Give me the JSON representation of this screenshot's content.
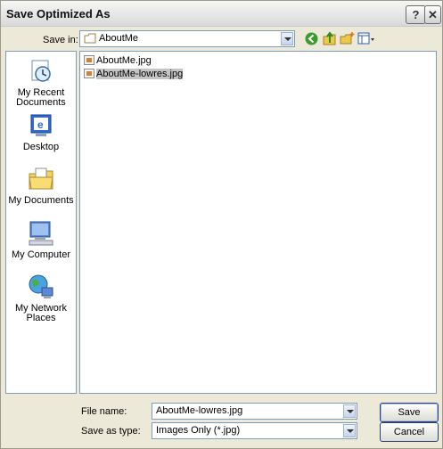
{
  "window": {
    "title": "Save Optimized As",
    "help_glyph": "?",
    "close_glyph": "✕"
  },
  "toolbar": {
    "save_in_label": "Save in:",
    "save_in_value": "AboutMe"
  },
  "places": [
    {
      "label": "My Recent Documents",
      "icon": "recent-documents-icon"
    },
    {
      "label": "Desktop",
      "icon": "desktop-icon"
    },
    {
      "label": "My Documents",
      "icon": "my-documents-icon"
    },
    {
      "label": "My Computer",
      "icon": "my-computer-icon"
    },
    {
      "label": "My Network Places",
      "icon": "network-places-icon"
    }
  ],
  "files": [
    {
      "name": "AboutMe.jpg",
      "selected": false
    },
    {
      "name": "AboutMe-lowres.jpg",
      "selected": true
    }
  ],
  "footer": {
    "file_name_label": "File name:",
    "file_name_value": "AboutMe-lowres.jpg",
    "save_type_label": "Save as type:",
    "save_type_value": "Images Only (*.jpg)",
    "save_button": "Save",
    "cancel_button": "Cancel"
  },
  "colors": {
    "background": "#ece9d8",
    "field_border": "#7f9db9",
    "selection": "#c5c5c5"
  }
}
